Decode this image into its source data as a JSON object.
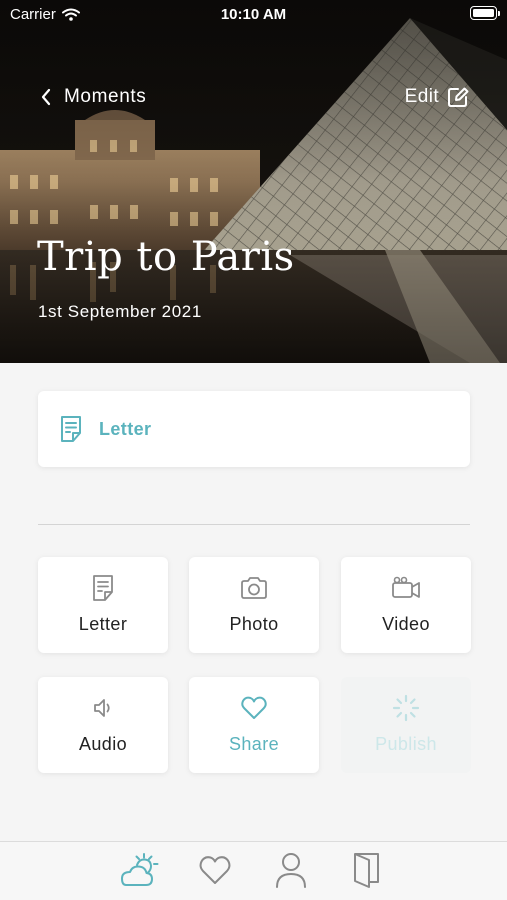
{
  "status_bar": {
    "carrier": "Carrier",
    "time": "10:10 AM"
  },
  "header": {
    "back_label": "Moments",
    "edit_label": "Edit",
    "title": "Trip to Paris",
    "date": "1st September 2021"
  },
  "primary_item": {
    "label": "Letter",
    "icon": "letter-icon"
  },
  "actions": [
    {
      "label": "Letter",
      "icon": "letter-icon"
    },
    {
      "label": "Photo",
      "icon": "camera-icon"
    },
    {
      "label": "Video",
      "icon": "video-camera-icon"
    },
    {
      "label": "Audio",
      "icon": "speaker-icon"
    },
    {
      "label": "Share",
      "icon": "heart-icon"
    },
    {
      "label": "Publish",
      "icon": "loading-spinner-icon"
    }
  ],
  "tab_bar": {
    "tabs": [
      {
        "icon": "weather-icon",
        "active": true
      },
      {
        "icon": "heart-icon",
        "active": false
      },
      {
        "icon": "profile-icon",
        "active": false
      },
      {
        "icon": "book-icon",
        "active": false
      }
    ]
  },
  "colors": {
    "accent": "#5bb3bd",
    "disabled_text": "#cde7e9",
    "background": "#f5f5f5",
    "card": "#ffffff",
    "text": "#222222",
    "icon_gray": "#8a8a8a"
  }
}
